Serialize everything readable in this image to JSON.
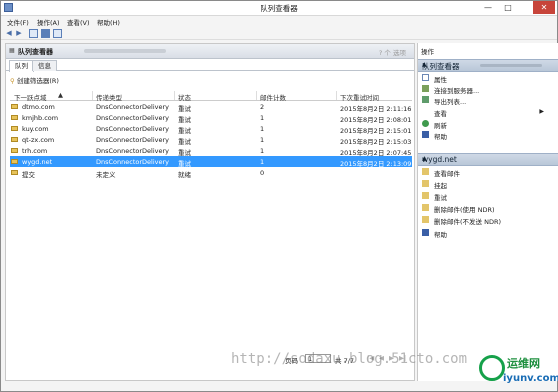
{
  "window": {
    "title": "队列查看器",
    "minimize": "—",
    "maximize": "□",
    "close": "✕"
  },
  "menu": [
    "文件(F)",
    "操作(A)",
    "查看(V)",
    "帮助(H)"
  ],
  "toolbar": {
    "back_icon": "arrow-left-icon",
    "forward_icon": "arrow-right-icon"
  },
  "panel": {
    "title": "队列查看器",
    "help_hint": "? 个 选项"
  },
  "tabs": [
    "队列",
    "信息"
  ],
  "filter_label": "创建筛选器(R)",
  "columns": [
    "下一跃点域",
    "传递类型",
    "状态",
    "邮件计数",
    "下次重试时间"
  ],
  "rows": [
    {
      "domain": "dtmo.com",
      "type": "DnsConnectorDelivery",
      "status": "重试",
      "count": "2",
      "next": "2015年8月2日 2:11:16"
    },
    {
      "domain": "kmjhb.com",
      "type": "DnsConnectorDelivery",
      "status": "重试",
      "count": "1",
      "next": "2015年8月2日 2:08:01"
    },
    {
      "domain": "kuy.com",
      "type": "DnsConnectorDelivery",
      "status": "重试",
      "count": "1",
      "next": "2015年8月2日 2:15:01"
    },
    {
      "domain": "qt-zx.com",
      "type": "DnsConnectorDelivery",
      "status": "重试",
      "count": "1",
      "next": "2015年8月2日 2:15:03"
    },
    {
      "domain": "trh.com",
      "type": "DnsConnectorDelivery",
      "status": "重试",
      "count": "1",
      "next": "2015年8月2日 2:07:45"
    },
    {
      "domain": "wygd.net",
      "type": "DnsConnectorDelivery",
      "status": "重试",
      "count": "1",
      "next": "2015年8月2日 2:13:09",
      "selected": true
    },
    {
      "domain": "提交",
      "type": "未定义",
      "status": "就绪",
      "count": "0",
      "next": ""
    }
  ],
  "pager": {
    "label": "页码",
    "page": "1",
    "of": "共 7/7"
  },
  "watermark": "http://sodaxu.blog.51cto.com",
  "actions": {
    "title": "操作",
    "section1": {
      "title": "队列查看器",
      "items": [
        "属性",
        "连接到服务器...",
        "导出列表...",
        "查看",
        "刷新",
        "帮助"
      ]
    },
    "section2": {
      "title": "wygd.net",
      "items": [
        "查看邮件",
        "挂起",
        "重试",
        "删除邮件(使用 NDR)",
        "删除邮件(不发送 NDR)",
        "帮助"
      ]
    }
  },
  "brand": {
    "name": "运维网",
    "domain": "iyunv.com"
  }
}
